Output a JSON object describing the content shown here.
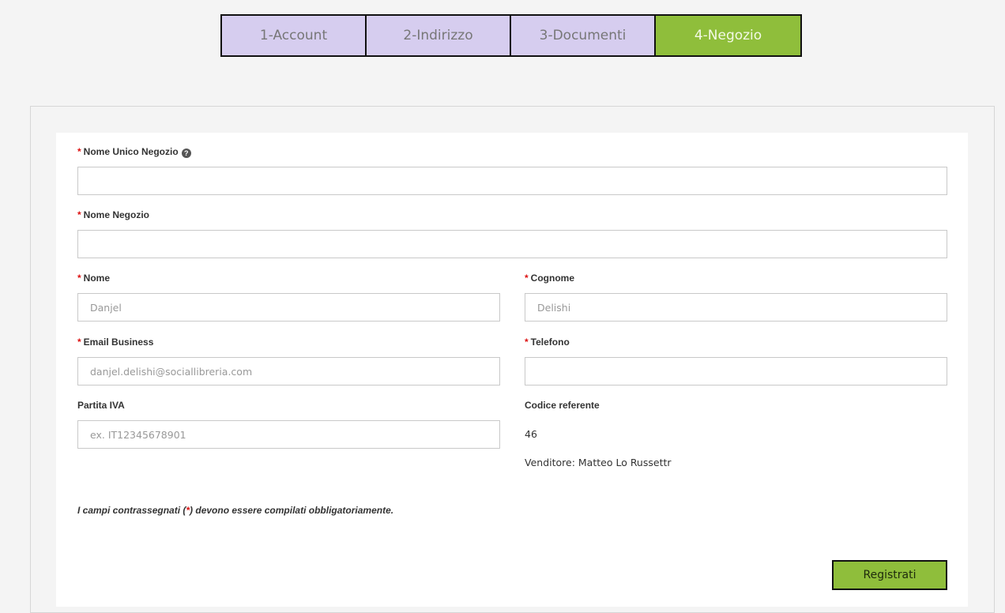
{
  "steps": [
    {
      "label": "1-Account"
    },
    {
      "label": "2-Indirizzo"
    },
    {
      "label": "3-Documenti"
    },
    {
      "label": "4-Negozio"
    }
  ],
  "form": {
    "required_mark": "*",
    "help_icon": "?",
    "unique_shop_name": {
      "label": "Nome Unico Negozio",
      "value": ""
    },
    "shop_name": {
      "label": "Nome Negozio",
      "value": ""
    },
    "first_name": {
      "label": "Nome",
      "placeholder": "Danjel"
    },
    "last_name": {
      "label": "Cognome",
      "placeholder": "Delishi"
    },
    "email": {
      "label": "Email Business",
      "placeholder": "danjel.delishi@sociallibreria.com"
    },
    "phone": {
      "label": "Telefono",
      "value": ""
    },
    "vat": {
      "label": "Partita IVA",
      "placeholder": "ex. IT12345678901"
    },
    "referral": {
      "label": "Codice referente",
      "code": "46",
      "seller": "Venditore: Matteo Lo Russettr"
    },
    "note_before": "I campi contrassegnati (",
    "note_star": "*",
    "note_after": ") devono essere compilati obbligatoriamente.",
    "submit_label": "Registrati"
  },
  "colors": {
    "active_step": "#8fbe3b",
    "inactive_step": "#d6cdef",
    "required": "#dd1111"
  }
}
